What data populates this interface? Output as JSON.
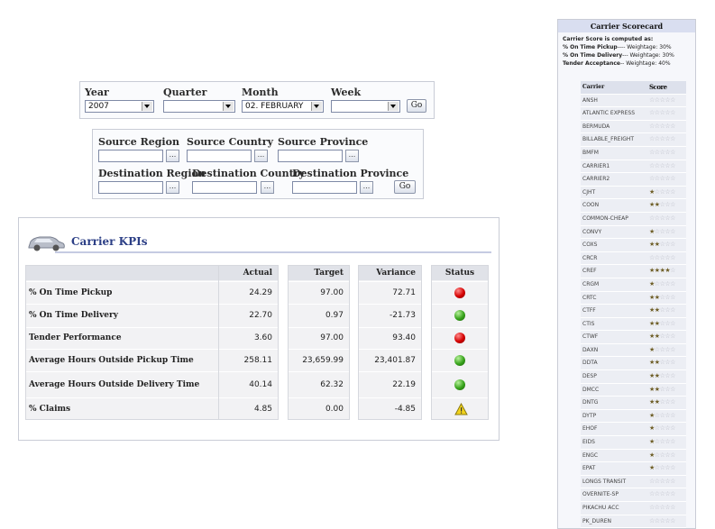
{
  "filters1": {
    "year_label": "Year",
    "year_value": "2007",
    "quarter_label": "Quarter",
    "quarter_value": "",
    "month_label": "Month",
    "month_value": "02. FEBRUARY",
    "week_label": "Week",
    "week_value": "",
    "go_label": "Go"
  },
  "filters2": {
    "source_region": "Source Region",
    "source_country": "Source Country",
    "source_province": "Source Province",
    "dest_region": "Destination Region",
    "dest_country": "Destination Country",
    "dest_province": "Destination Province",
    "ellipsis": "...",
    "go_label": "Go"
  },
  "kpi": {
    "title": "Carrier KPIs",
    "headers": {
      "actual": "Actual",
      "target": "Target",
      "variance": "Variance",
      "status": "Status"
    },
    "rows": [
      {
        "metric": "% On Time Pickup",
        "actual": "24.29",
        "target": "97.00",
        "variance": "72.71",
        "status": "red"
      },
      {
        "metric": "% On Time Delivery",
        "actual": "22.70",
        "target": "0.97",
        "variance": "-21.73",
        "status": "green"
      },
      {
        "metric": "Tender Performance",
        "actual": "3.60",
        "target": "97.00",
        "variance": "93.40",
        "status": "red"
      },
      {
        "metric": "Average Hours Outside Pickup Time",
        "actual": "258.11",
        "target": "23,659.99",
        "variance": "23,401.87",
        "status": "green"
      },
      {
        "metric": "Average Hours Outside Delivery Time",
        "actual": "40.14",
        "target": "62.32",
        "variance": "22.19",
        "status": "green"
      },
      {
        "metric": "% Claims",
        "actual": "4.85",
        "target": "0.00",
        "variance": "-4.85",
        "status": "warning"
      }
    ],
    "colors": {
      "red": "#d40000",
      "green": "#36a21a",
      "warning": "#f1d21c",
      "title": "#2c3f86"
    }
  },
  "scorecard": {
    "title": "Carrier Scorecard",
    "intro": "Carrier Score is computed as:",
    "weights": [
      {
        "label": "% On Time Pickup",
        "weight": "---- Weightage: 30%"
      },
      {
        "label": "% On Time Delivery",
        "weight": "--- Weightage: 30%"
      },
      {
        "label": "Tender Acceptance",
        "weight": "-- Weightage: 40%"
      }
    ],
    "col_carrier": "Carrier",
    "col_score": "Score",
    "carriers": [
      {
        "name": "ANSH",
        "stars": 0
      },
      {
        "name": "ATLANTIC EXPRESS",
        "stars": 0
      },
      {
        "name": "BERMUDA",
        "stars": 0
      },
      {
        "name": "BILLABLE_FREIGHT",
        "stars": 0
      },
      {
        "name": "BMFM",
        "stars": 0
      },
      {
        "name": "CARRIER1",
        "stars": 0
      },
      {
        "name": "CARRIER2",
        "stars": 0
      },
      {
        "name": "CJHT",
        "stars": 1
      },
      {
        "name": "COON",
        "stars": 2
      },
      {
        "name": "COMMON-CHEAP",
        "stars": 0
      },
      {
        "name": "CONVY",
        "stars": 1
      },
      {
        "name": "COXS",
        "stars": 2
      },
      {
        "name": "CRCR",
        "stars": 0
      },
      {
        "name": "CREF",
        "stars": 4
      },
      {
        "name": "CRGM",
        "stars": 1
      },
      {
        "name": "CRTC",
        "stars": 2
      },
      {
        "name": "CTFF",
        "stars": 2
      },
      {
        "name": "CTIS",
        "stars": 2
      },
      {
        "name": "CTWF",
        "stars": 2
      },
      {
        "name": "DAXN",
        "stars": 1
      },
      {
        "name": "DDTA",
        "stars": 2
      },
      {
        "name": "DESP",
        "stars": 2
      },
      {
        "name": "DMCC",
        "stars": 2
      },
      {
        "name": "DNTG",
        "stars": 2
      },
      {
        "name": "DYTP",
        "stars": 1
      },
      {
        "name": "EHOF",
        "stars": 1
      },
      {
        "name": "EIDS",
        "stars": 1
      },
      {
        "name": "ENGC",
        "stars": 1
      },
      {
        "name": "EPAT",
        "stars": 1
      },
      {
        "name": "LONGS TRANSIT",
        "stars": 0
      },
      {
        "name": "OVERNITE-SP",
        "stars": 0
      },
      {
        "name": "PIKACHU ACC",
        "stars": 0
      },
      {
        "name": "PK_DUREN",
        "stars": 0
      }
    ]
  }
}
